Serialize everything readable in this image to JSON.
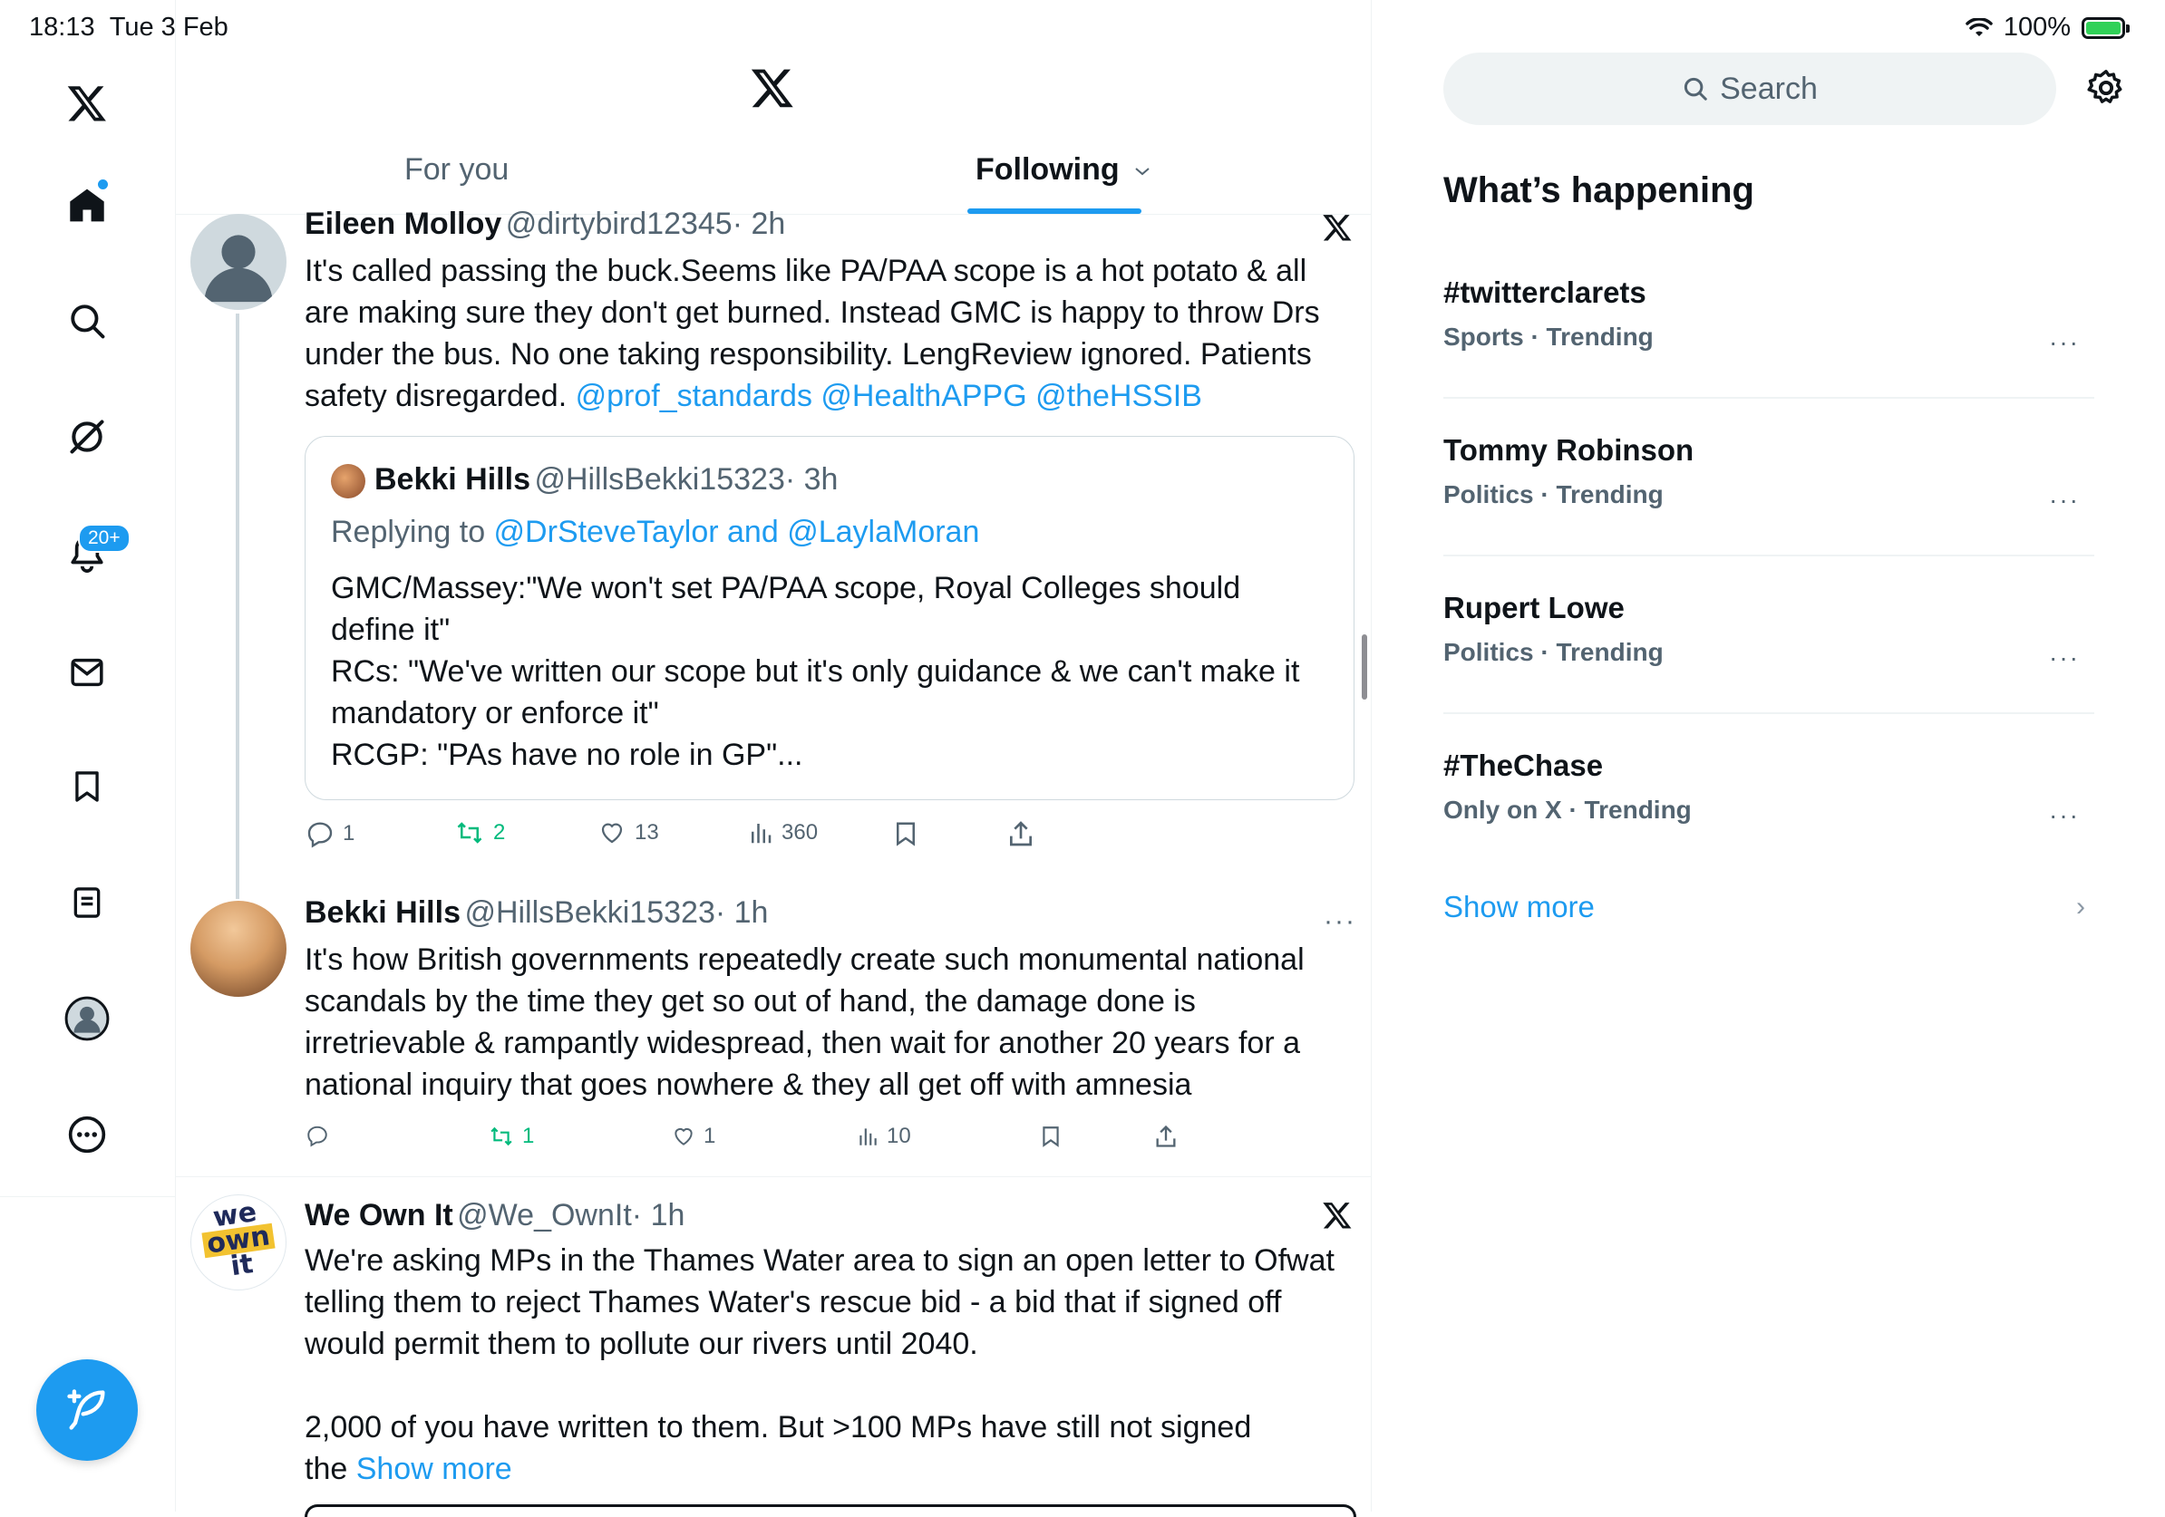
{
  "status_bar": {
    "time": "18:13",
    "date": "Tue 3 Feb",
    "battery": "100%"
  },
  "nav": {
    "notifications_badge": "20+"
  },
  "tabs": {
    "for_you": "For you",
    "following": "Following"
  },
  "tweets": [
    {
      "name": "Eileen Molloy",
      "handle": "@dirtybird12345",
      "time": "· 2h",
      "text": "It's called passing the buck.Seems like PA/PAA scope is a hot potato & all\nare making sure they don't get burned. Instead GMC is happy to throw Drs\nunder the bus. No one taking responsibility. LengReview ignored. Patients\nsafety disregarded. ",
      "mentions": "@prof_standards @HealthAPPG @theHSSIB",
      "quote": {
        "name": "Bekki Hills",
        "handle": "@HillsBekki15323",
        "time": "· 3h",
        "replying_prefix": "Replying to ",
        "replying_to": "@DrSteveTaylor and @LaylaMoran",
        "text": "GMC/Massey:\"We won't set PA/PAA scope, Royal Colleges should\ndefine it\"\nRCs: \"We've written our scope but it's only guidance & we can't make it\nmandatory or enforce it\"\nRCGP: \"PAs have no role in GP\"..."
      },
      "replies": "1",
      "reposts": "2",
      "likes": "13",
      "views": "360"
    },
    {
      "name": "Bekki Hills",
      "handle": "@HillsBekki15323",
      "time": "· 1h",
      "text": "It's how British governments repeatedly create such monumental national\nscandals by the time they get so out of hand, the damage done is\nirretrievable & rampantly widespread, then wait for another 20 years for a\nnational inquiry that goes nowhere & they all get off with amnesia",
      "replies": "",
      "reposts": "1",
      "likes": "1",
      "views": "10"
    },
    {
      "name": "We Own It",
      "handle": "@We_OwnIt",
      "time": "· 1h",
      "avatar_text": [
        "we",
        "own",
        "it"
      ],
      "text": "We're asking MPs in the Thames Water area to sign an open letter to Ofwat\ntelling them to reject Thames Water's rescue bid - a bid that if signed off\nwould permit them to pollute our rivers until 2040.\n\n2,000 of you have written to them. But >100 MPs have still not signed\nthe ",
      "show_more": "Show more"
    }
  ],
  "sidebar": {
    "search_placeholder": "Search",
    "whats_happening": "What’s happening",
    "trends": [
      {
        "name": "#twitterclarets",
        "meta": "Sports · Trending"
      },
      {
        "name": "Tommy Robinson",
        "meta": "Politics · Trending"
      },
      {
        "name": "Rupert Lowe",
        "meta": "Politics · Trending"
      },
      {
        "name": "#TheChase",
        "meta": "Only on X · Trending"
      }
    ],
    "show_more": "Show more"
  },
  "colors": {
    "accent": "#1d9bf0",
    "repost": "#00ba7c",
    "secondary_text": "#536471"
  }
}
